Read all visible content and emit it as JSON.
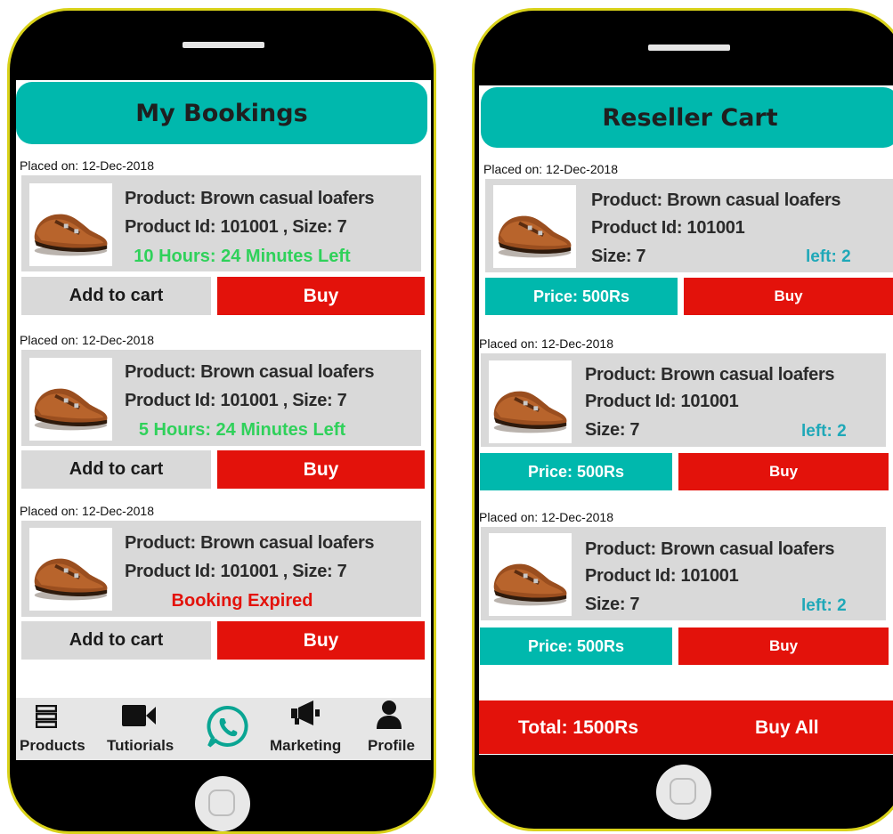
{
  "colors": {
    "teal": "#00b8ad",
    "red": "#e3120b",
    "green": "#2fd15a",
    "expired": "#e3120b",
    "left_blue": "#1fa8b8",
    "frame": "#d9d21a"
  },
  "bookings": {
    "title": "My Bookings",
    "items": [
      {
        "placed": "Placed on: 12-Dec-2018",
        "product": "Product: Brown casual loafers",
        "id_size": "Product Id: 101001 , Size: 7",
        "status": "10 Hours: 24 Minutes Left",
        "status_type": "time",
        "cart_label": "Add to cart",
        "buy_label": "Buy"
      },
      {
        "placed": "Placed on: 12-Dec-2018",
        "product": "Product: Brown casual loafers",
        "id_size": "Product Id: 101001 , Size: 7",
        "status": "5 Hours: 24 Minutes Left",
        "status_type": "time",
        "cart_label": "Add to cart",
        "buy_label": "Buy"
      },
      {
        "placed": "Placed on: 12-Dec-2018",
        "product": "Product: Brown casual loafers",
        "id_size": "Product Id: 101001 , Size: 7",
        "status": "Booking Expired",
        "status_type": "expired",
        "cart_label": "Add to cart",
        "buy_label": "Buy"
      }
    ],
    "nav": [
      {
        "label": "Products",
        "icon": "list-icon"
      },
      {
        "label": "Tutiorials",
        "icon": "video-camera-icon"
      },
      {
        "label": "",
        "icon": "whatsapp-icon"
      },
      {
        "label": "Marketing",
        "icon": "megaphone-icon"
      },
      {
        "label": "Profile",
        "icon": "user-icon"
      }
    ]
  },
  "cart": {
    "title": "Reseller Cart",
    "items": [
      {
        "placed": "Placed on: 12-Dec-2018",
        "product": "Product: Brown casual loafers",
        "product_id": "Product Id: 101001",
        "size": "Size: 7",
        "left": "left: 2",
        "price": "Price: 500Rs",
        "buy_label": "Buy"
      },
      {
        "placed": "Placed on: 12-Dec-2018",
        "product": "Product: Brown casual loafers",
        "product_id": "Product Id: 101001",
        "size": "Size: 7",
        "left": "left: 2",
        "price": "Price: 500Rs",
        "buy_label": "Buy"
      },
      {
        "placed": "Placed on: 12-Dec-2018",
        "product": "Product: Brown casual loafers",
        "product_id": "Product Id: 101001",
        "size": "Size: 7",
        "left": "left: 2",
        "price": "Price: 500Rs",
        "buy_label": "Buy"
      }
    ],
    "total": "Total: 1500Rs",
    "buy_all": "Buy All"
  }
}
